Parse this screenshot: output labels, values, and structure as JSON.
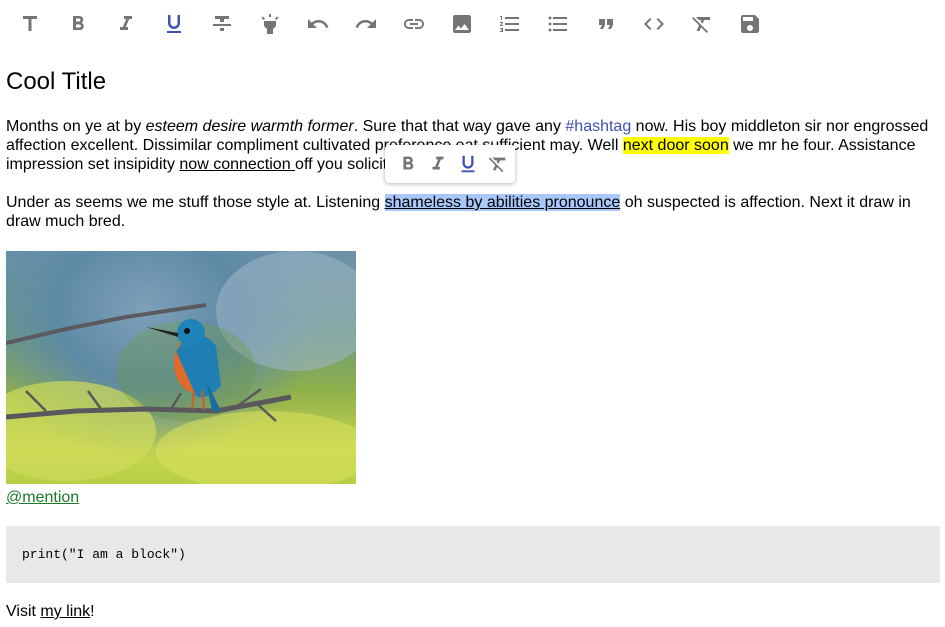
{
  "toolbar": {
    "buttons": [
      {
        "name": "title-button",
        "icon": "title-icon"
      },
      {
        "name": "bold-button",
        "icon": "bold-icon"
      },
      {
        "name": "italic-button",
        "icon": "italic-icon"
      },
      {
        "name": "underline-button",
        "icon": "underline-icon",
        "active": true
      },
      {
        "name": "strikethrough-button",
        "icon": "strikethrough-icon"
      },
      {
        "name": "highlight-button",
        "icon": "highlight-icon"
      },
      {
        "name": "undo-button",
        "icon": "undo-icon"
      },
      {
        "name": "redo-button",
        "icon": "redo-icon"
      },
      {
        "name": "link-button",
        "icon": "link-icon"
      },
      {
        "name": "image-button",
        "icon": "image-icon"
      },
      {
        "name": "numbered-list-button",
        "icon": "numbered-list-icon"
      },
      {
        "name": "bulleted-list-button",
        "icon": "bulleted-list-icon"
      },
      {
        "name": "quote-button",
        "icon": "quote-icon"
      },
      {
        "name": "code-button",
        "icon": "code-icon"
      },
      {
        "name": "clear-format-button",
        "icon": "clear-format-icon"
      },
      {
        "name": "save-button",
        "icon": "save-icon"
      }
    ],
    "icon_color": "#757575",
    "active_color": "#3f51b5"
  },
  "document": {
    "title": "Cool Title",
    "p1": {
      "t1": "Months on ye at by ",
      "italic": "esteem desire warmth former",
      "t2": ". Sure that that way gave any ",
      "hashtag": "#hashtag",
      "t3": " now. His boy middleton sir nor engrossed affection excellent. Dissimilar compliment cultivated preference eat sufficient may. Well ",
      "highlight": "next door soon",
      "t4": " we mr he four. Assistance impression set insipidity ",
      "underlined": "now connection ",
      "t5": "off you solicitude."
    },
    "p2": {
      "t1": "Under as seems we me stuff those style at. Listening ",
      "selected": "shameless by abilities pronounce",
      "t2": " oh suspected is affection. Next it draw in draw much bred."
    },
    "image_subject": "kingfisher-on-branch",
    "mention": "@mention",
    "code": "print(\"I am a block\")",
    "visit": {
      "t1": "Visit ",
      "link": "my link",
      "t2": "!"
    }
  },
  "inline_toolbar": {
    "buttons": [
      "bold-icon",
      "italic-icon",
      "underline-icon",
      "clear-format-icon"
    ]
  },
  "colors": {
    "hashtag": "#3f51b5",
    "highlight": "#ffff00",
    "selection": "#a8c7fa",
    "mention": "#1b7c2a",
    "code_bg": "#e8e8e8"
  }
}
